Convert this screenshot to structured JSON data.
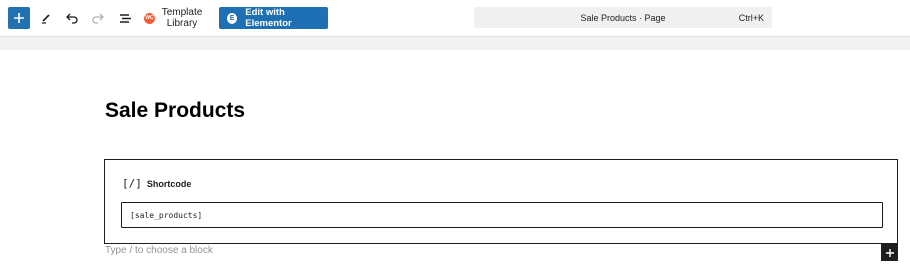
{
  "toolbar": {
    "template_library_label": "Template Library",
    "template_logo_text": "WC",
    "elementor_label": "Edit with Elementor",
    "elementor_icon_text": "E"
  },
  "command_bar": {
    "title": "Sale Products · Page",
    "shortcut": "Ctrl+K"
  },
  "page": {
    "title": "Sale Products"
  },
  "shortcode_block": {
    "icon_text": "[/]",
    "label": "Shortcode",
    "value": "[sale_products]"
  },
  "appender": {
    "placeholder": "Type / to choose a block"
  },
  "colors": {
    "primary": "#2271b1",
    "elementor": "#1e6fb3",
    "dark": "#1e1e1e"
  },
  "icons": [
    "plus-icon",
    "pencil-icon",
    "undo-icon",
    "redo-icon",
    "list-view-icon",
    "plus-icon"
  ]
}
